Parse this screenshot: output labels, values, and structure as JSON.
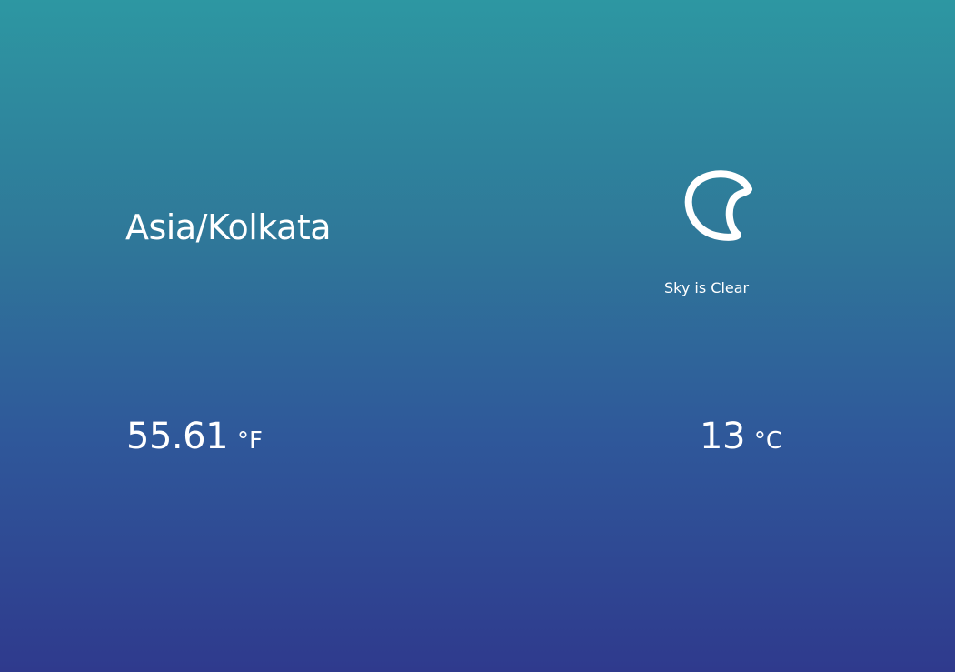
{
  "location": {
    "timezone": "Asia/Kolkata"
  },
  "weather": {
    "icon": "crescent-moon-icon",
    "description": "Sky is Clear"
  },
  "temperature": {
    "fahrenheit": {
      "value": "55.61",
      "unit": "°F"
    },
    "celsius": {
      "value": "13",
      "unit": "°C"
    }
  },
  "colors": {
    "background_top": "#2d97a2",
    "background_bottom": "#2f3a8d",
    "text": "#ffffff"
  }
}
